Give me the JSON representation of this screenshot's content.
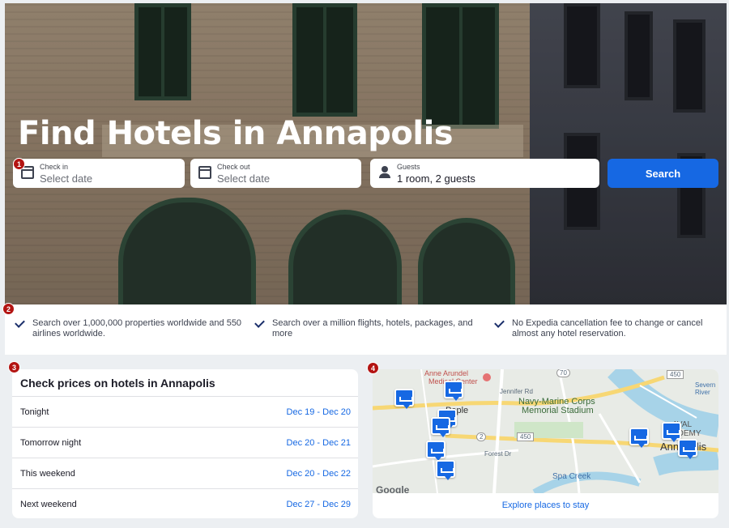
{
  "hero": {
    "title": "Find Hotels in Annapolis",
    "check_in": {
      "label": "Check in",
      "value": "Select date",
      "icon": "calendar-icon"
    },
    "check_out": {
      "label": "Check out",
      "value": "Select date",
      "icon": "calendar-icon"
    },
    "guests": {
      "label": "Guests",
      "value": "1 room, 2 guests",
      "icon": "person-icon"
    },
    "search_label": "Search"
  },
  "badges": [
    "1",
    "2",
    "3",
    "4"
  ],
  "benefits": [
    "Search over 1,000,000 properties worldwide and 550 airlines worldwide.",
    "Search over a million flights, hotels, packages, and more",
    "No Expedia cancellation fee to change or cancel almost any hotel reservation."
  ],
  "prices": {
    "title": "Check prices on hotels in Annapolis",
    "rows": [
      {
        "label": "Tonight",
        "dates": "Dec 19 - Dec 20"
      },
      {
        "label": "Tomorrow night",
        "dates": "Dec 20 - Dec 21"
      },
      {
        "label": "This weekend",
        "dates": "Dec 20 - Dec 22"
      },
      {
        "label": "Next weekend",
        "dates": "Dec 27 - Dec 29"
      }
    ]
  },
  "map": {
    "labels": {
      "anne_arundel": "Anne Arundel",
      "medical_center": "Medical Center",
      "navy_marine": "Navy-Marine Corps",
      "memorial_stadium": "Memorial Stadium",
      "annapolis": "Annapolis",
      "spa_creek": "Spa Creek",
      "naval_academy": "AVAL ADEMY",
      "jennifer_rd": "Jennifer Rd",
      "forest_dr": "Forest Dr",
      "severn_river": "Severn River",
      "people": "Peple",
      "route_70": "70",
      "route_450a": "450",
      "route_450b": "450",
      "route_2": "2",
      "google": "Google"
    },
    "explore_label": "Explore places to stay"
  },
  "colors": {
    "accent": "#1668e3",
    "badge": "#b31412"
  }
}
